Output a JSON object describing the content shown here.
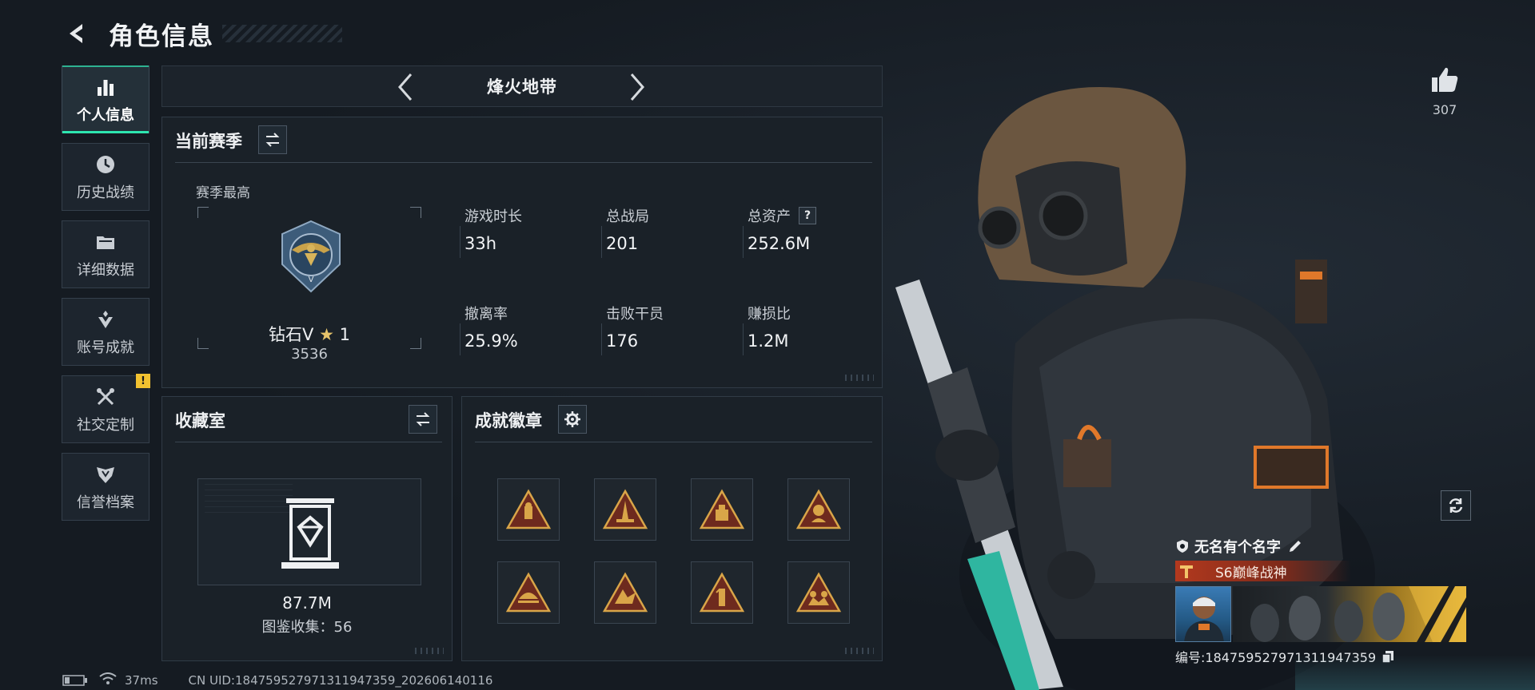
{
  "header": {
    "title": "角色信息"
  },
  "sidebar": {
    "items": [
      {
        "label": "个人信息",
        "icon": "bar-chart-icon",
        "active": true
      },
      {
        "label": "历史战绩",
        "icon": "clock-icon",
        "active": false
      },
      {
        "label": "详细数据",
        "icon": "folder-icon",
        "active": false
      },
      {
        "label": "账号成就",
        "icon": "trophy-icon",
        "active": false
      },
      {
        "label": "社交定制",
        "icon": "tools-icon",
        "active": false,
        "badge": "!"
      },
      {
        "label": "信誉档案",
        "icon": "shield-icon",
        "active": false
      }
    ]
  },
  "mode": {
    "title": "烽火地带"
  },
  "season": {
    "title": "当前赛季",
    "best_label": "赛季最高",
    "rank_name": "钻石V",
    "rank_stars": "1",
    "rank_score": "3536",
    "stats": [
      {
        "label": "游戏时长",
        "value": "33h"
      },
      {
        "label": "总战局",
        "value": "201"
      },
      {
        "label": "总资产",
        "value": "252.6M",
        "help": "?"
      },
      {
        "label": "撤离率",
        "value": "25.9%"
      },
      {
        "label": "击败干员",
        "value": "176"
      },
      {
        "label": "赚损比",
        "value": "1.2M"
      }
    ]
  },
  "collection": {
    "title": "收藏室",
    "value": "87.7M",
    "count_text": "图鉴收集：56"
  },
  "achievements": {
    "title": "成就徽章",
    "medals": [
      "medal-icon",
      "medal-icon",
      "medal-icon",
      "medal-icon",
      "medal-icon",
      "medal-icon",
      "medal-icon",
      "medal-icon"
    ]
  },
  "likes": {
    "count": "307"
  },
  "player": {
    "name": "无名有个名字",
    "title_tag": "S6巅峰战神",
    "uid_text": "编号:1847595279713119473​59"
  },
  "status": {
    "ping": "37ms",
    "cn_uid": "CN UID:1847595279713119473​59_202606140116"
  },
  "colors": {
    "accent": "#2ee6b0",
    "title_tag": "#b3391e",
    "gold": "#e6c36a",
    "warning": "#f2c230"
  }
}
